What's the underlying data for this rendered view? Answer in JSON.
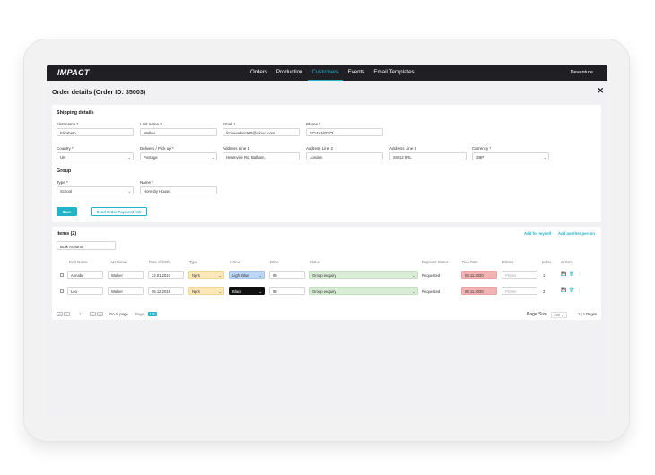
{
  "app": {
    "logo": "IMPACT",
    "nav": [
      "Orders",
      "Production",
      "Customers",
      "Events",
      "Email Templates"
    ],
    "active_nav": "Customers",
    "user": "Deventure"
  },
  "order": {
    "title": "Order details (Order ID: 35003)",
    "close": "✕"
  },
  "shipping": {
    "title": "Shipping details",
    "first_name": {
      "label": "First name *",
      "value": "Elizabeth"
    },
    "last_name": {
      "label": "Last name *",
      "value": "Walker"
    },
    "email": {
      "label": "Email *",
      "value": "lizziewalker200@icloud.com"
    },
    "phone": {
      "label": "Phone *",
      "value": "07149182072"
    },
    "country": {
      "label": "Country *",
      "value": "UK"
    },
    "delivery": {
      "label": "Delivery / Pick up *",
      "value": "Postage"
    },
    "address1": {
      "label": "Address Line 1",
      "value": "Heamville Rd, Balham,"
    },
    "address2": {
      "label": "Address Line 2",
      "value": "London"
    },
    "address3": {
      "label": "Address Line 3",
      "value": "SW12 8RL"
    },
    "currency": {
      "label": "Currency *",
      "value": "GBP"
    }
  },
  "group": {
    "title": "Group",
    "type": {
      "label": "Type *",
      "value": "School"
    },
    "name": {
      "label": "Name *",
      "value": "Hornsby House"
    }
  },
  "buttons": {
    "save": "Save",
    "send_link": "Send Order Payment link"
  },
  "items": {
    "title": "Items (2)",
    "add_myself": "Add for myself",
    "add_another": "Add another person",
    "bulk_actions": "Bulk Actions",
    "columns": [
      "First Name",
      "Last Name",
      "Date of birth",
      "Type",
      "Colour",
      "Price",
      "Status",
      "Payment Status",
      "Due Date",
      "Printer",
      "Index",
      "Actions"
    ],
    "rows": [
      {
        "first": "Annabe",
        "last": "Walker",
        "dob": "22.01.2010",
        "type": "Nprs",
        "colour": "Light Blue",
        "colour_hex": "#bcd6f5",
        "price": "94",
        "status": "Group enquiry",
        "payment": "Requested",
        "due": "08.11.2020",
        "printer": "Printer",
        "index": "1"
      },
      {
        "first": "Leo",
        "last": "Walker",
        "dob": "05.12.2018",
        "type": "Nprs",
        "colour": "Black",
        "colour_hex": "#111111",
        "price": "94",
        "status": "Group enquiry",
        "payment": "Requested",
        "due": "08.11.2020",
        "printer": "Printer",
        "index": "2"
      }
    ]
  },
  "pagination": {
    "first": "<<",
    "prev": "<",
    "current": "1",
    "next": ">",
    "last": ">>",
    "go_to_page": "Go to page",
    "page_label": "Page",
    "page_input": "100",
    "page_size_label": "Page Size",
    "page_size": "100",
    "pages": "1 | 1 Pages"
  },
  "colors": {
    "accent": "#21b3c6",
    "nav_bg": "#1f1f24",
    "status_bg": "#d9ecd6",
    "due_bg": "#f3b3b3",
    "type_bg": "#fbe7b8"
  }
}
